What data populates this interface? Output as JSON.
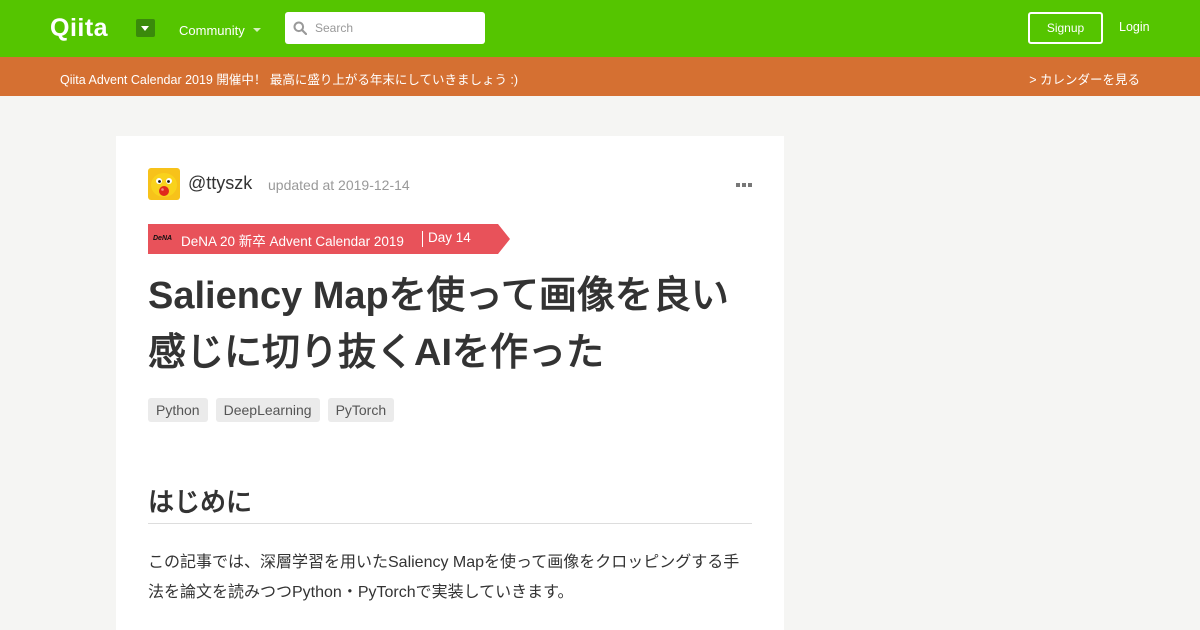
{
  "header": {
    "logo": "Qiita",
    "community_label": "Community",
    "search": {
      "placeholder": "Search",
      "value": ""
    },
    "signup_label": "Signup",
    "login_label": "Login"
  },
  "banner": {
    "text": "Qiita Advent Calendar 2019 開催中！ 最高に盛り上がる年末にしていきましょう :)",
    "link": "> カレンダーを見る"
  },
  "article": {
    "author": "@ttyszk",
    "updated": "updated at 2019-12-14",
    "advent": {
      "logo_text": "DeNA",
      "calendar": "DeNA 20 新卒 Advent Calendar 2019",
      "day": "Day 14",
      "color": "#e8525a"
    },
    "title": "Saliency Mapを使って画像を良い感じに切り抜くAIを作った",
    "tags": [
      "Python",
      "DeepLearning",
      "PyTorch"
    ],
    "heading": "はじめに",
    "intro": "この記事では、深層学習を用いたSaliency Mapを使って画像をクロッピングする手法を論文を読みつつPython・PyTorchで実装していきます。"
  },
  "colors": {
    "header_bg": "#55c500",
    "banner_bg": "#d57032",
    "page_bg": "#f5f5f3"
  },
  "icons": [
    "qiita-logo",
    "chevron-down-icon",
    "search-icon",
    "more-icon",
    "avatar"
  ]
}
